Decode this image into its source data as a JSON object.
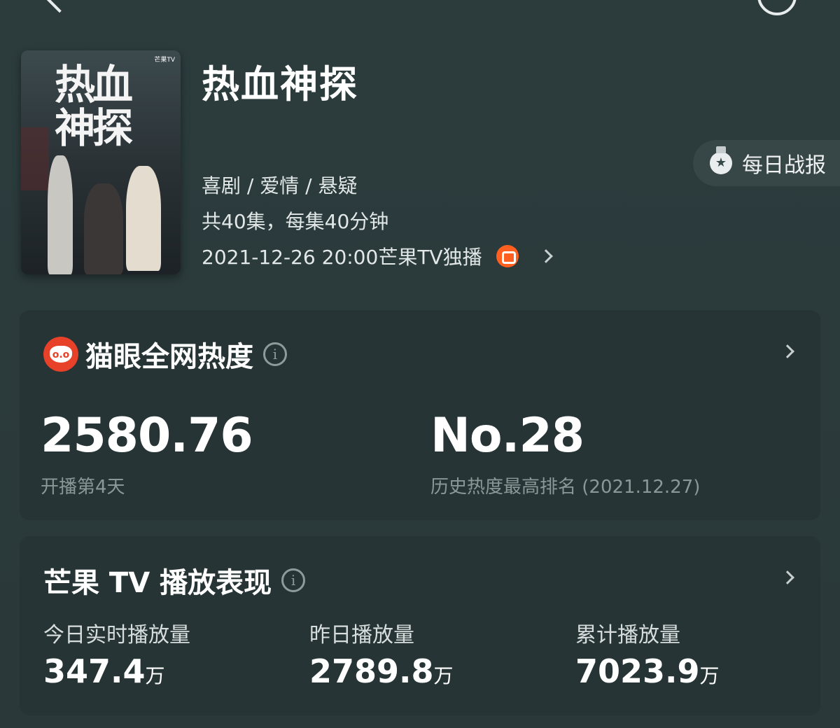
{
  "show": {
    "title": "热血神探",
    "poster_text": "热血神探",
    "poster_badge": "芒果TV",
    "genres": "喜剧 / 爱情 / 悬疑",
    "episodes": "共40集，每集40分钟",
    "airing": "2021-12-26 20:00芒果TV独播"
  },
  "daily_report": {
    "label": "每日战报"
  },
  "heat_card": {
    "title": "猫眼全网热度",
    "value": "2580.76",
    "days_label": "开播第4天",
    "rank": "No.28",
    "rank_label": "历史热度最高排名 (2021.12.27)"
  },
  "play_card": {
    "title": "芒果 TV 播放表现",
    "stats": [
      {
        "label": "今日实时播放量",
        "value": "347.4",
        "unit": "万"
      },
      {
        "label": "昨日播放量",
        "value": "2789.8",
        "unit": "万"
      },
      {
        "label": "累计播放量",
        "value": "7023.9",
        "unit": "万"
      }
    ]
  },
  "colors": {
    "background": "#2a3a3b",
    "card": "#263435",
    "maoyan_red": "#e8412a",
    "mango_orange": "#ff5f1f"
  }
}
